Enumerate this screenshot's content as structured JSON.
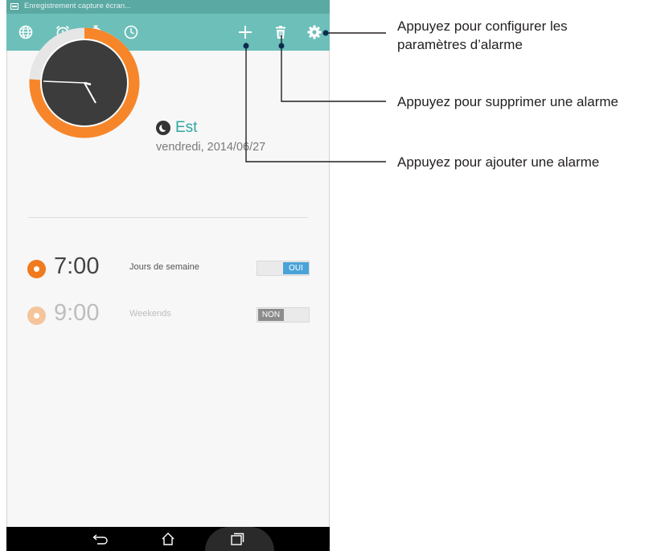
{
  "status_bar": {
    "notification_text": "Enregistrement capture écran..."
  },
  "action_bar": {
    "icons": [
      "world-clock-icon",
      "alarm-icon",
      "stopwatch-icon",
      "timer-icon",
      "add-icon",
      "delete-icon",
      "settings-icon"
    ]
  },
  "clock": {
    "timezone_name": "Est",
    "date": "vendredi, 2014/06/27"
  },
  "alarms": [
    {
      "time": "7:00",
      "days": "Jours de semaine",
      "toggle": "OUI",
      "enabled": true
    },
    {
      "time": "9:00",
      "days": "Weekends",
      "toggle": "NON",
      "enabled": false
    }
  ],
  "nav_bar": {
    "icons": [
      "back-icon",
      "home-icon",
      "recent-apps-icon"
    ]
  },
  "callouts": {
    "settings_line1": "Appuyez pour configurer les",
    "settings_line2": "paramètres d’alarme",
    "delete": "Appuyez pour supprimer une alarme",
    "add": "Appuyez pour ajouter une alarme"
  },
  "colors": {
    "accent_teal": "#6dbfb9",
    "status_teal": "#5aa9a3",
    "clock_orange": "#f7862a",
    "toggle_on_blue": "#4aa3d8",
    "toggle_off_gray": "#8c8c8c"
  }
}
